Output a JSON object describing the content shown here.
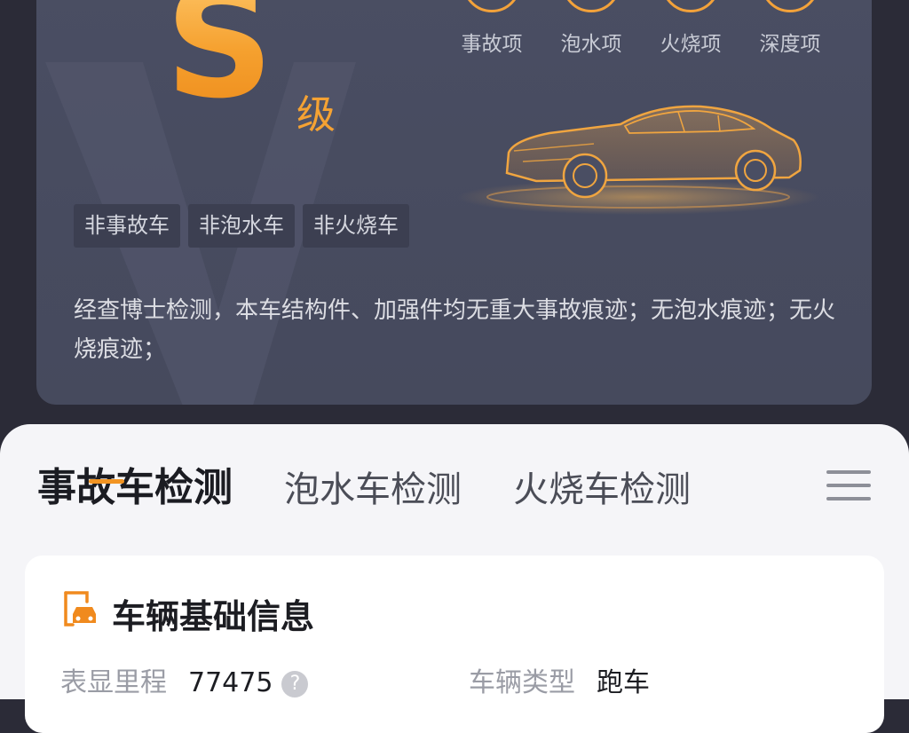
{
  "report": {
    "grade_letter": "S",
    "grade_suffix": "级",
    "check_items": [
      "事故项",
      "泡水项",
      "火烧项",
      "深度项"
    ],
    "tags": [
      "非事故车",
      "非泡水车",
      "非火烧车"
    ],
    "summary": "经查博士检测，本车结构件、加强件均无重大事故痕迹；无泡水痕迹；无火烧痕迹；",
    "accent_color": "#f5a233"
  },
  "tabs": [
    {
      "label": "事故车检测",
      "active": true
    },
    {
      "label": "泡水车检测",
      "active": false
    },
    {
      "label": "火烧车检测",
      "active": false
    }
  ],
  "info_card": {
    "title": "车辆基础信息",
    "fields": [
      {
        "label": "表显里程",
        "value": "77475"
      },
      {
        "label": "车辆类型",
        "value": "跑车"
      }
    ]
  }
}
